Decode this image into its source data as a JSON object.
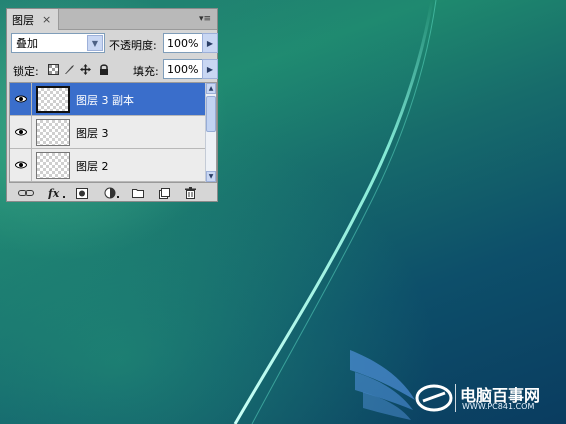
{
  "panel": {
    "tab_label": "图层",
    "close_glyph": "×",
    "menu_glyph": "▾≡",
    "blend_mode": "叠加",
    "opacity_label": "不透明度:",
    "opacity_value": "100%",
    "lock_label": "锁定:",
    "fill_label": "填充:",
    "fill_value": "100%",
    "lock_icons": [
      "lock-transparent-icon",
      "lock-paint-icon",
      "lock-move-icon",
      "lock-all-icon"
    ],
    "layers": [
      {
        "name": "图层 3 副本",
        "selected": true,
        "visible": true
      },
      {
        "name": "图层 3",
        "selected": false,
        "visible": true
      },
      {
        "name": "图层 2",
        "selected": false,
        "visible": true
      }
    ],
    "bottom_icons": [
      "link-layers-icon",
      "layer-style-icon",
      "add-mask-icon",
      "adjustment-layer-icon",
      "new-group-icon",
      "new-layer-icon",
      "delete-layer-icon"
    ]
  },
  "watermark": {
    "brand": "电脑百事网",
    "url": "WWW.PC841.COM"
  },
  "colors": {
    "selection": "#3a6ecb",
    "panel_bg": "#d6d6d6",
    "desktop_teal": "#1f8a6e",
    "desktop_blue": "#0a3c60"
  }
}
